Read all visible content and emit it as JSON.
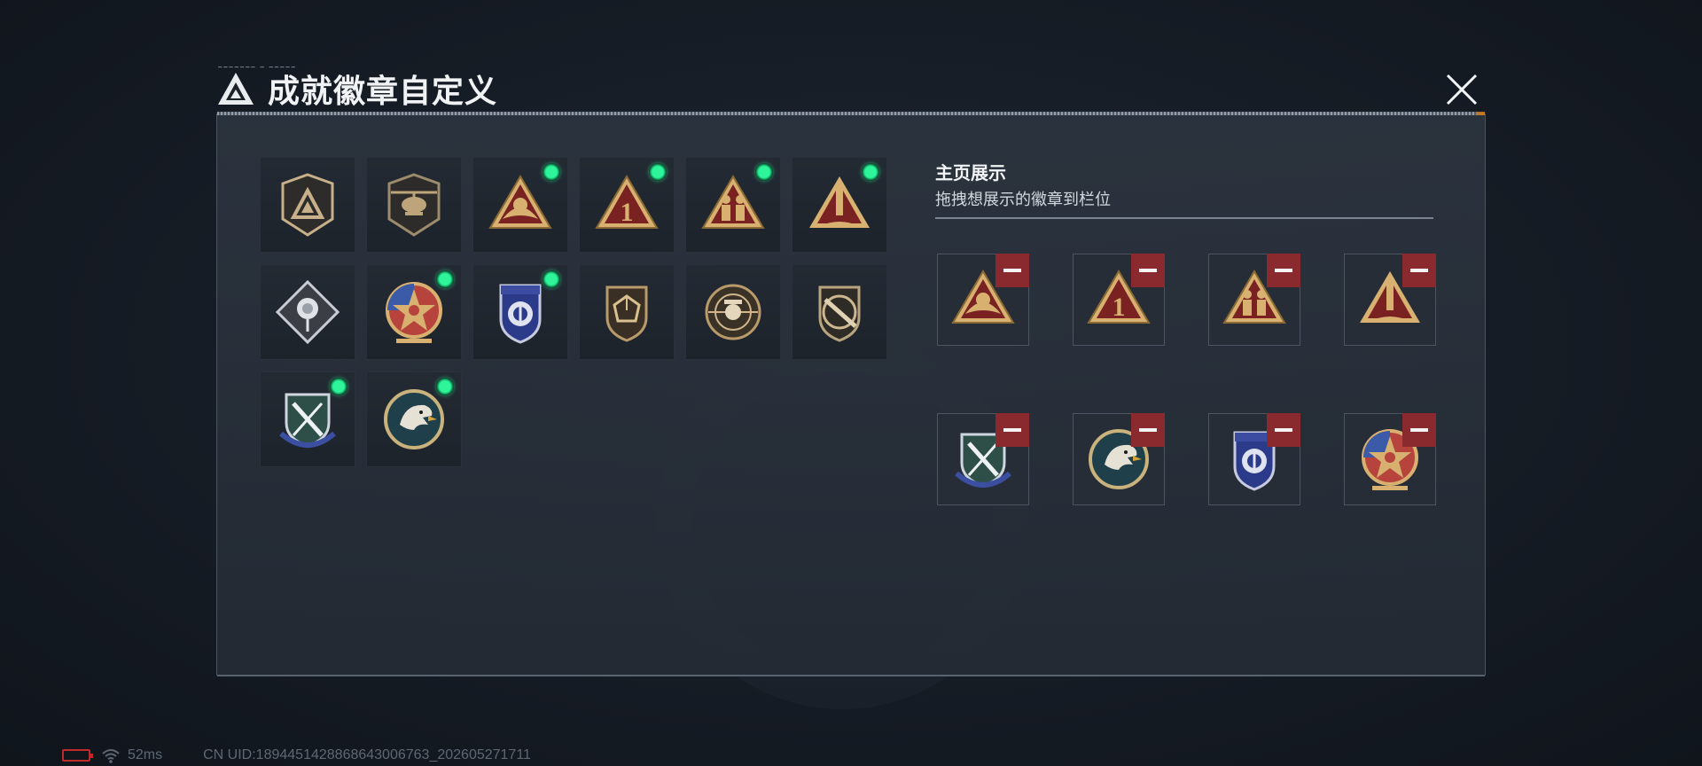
{
  "title": {
    "text": "成就徽章自定义",
    "deco_text": "━━━━━━━ ━ ━━━━━"
  },
  "showcase": {
    "title": "主页展示",
    "subtitle": "拖拽想展示的徽章到栏位"
  },
  "colors": {
    "equipped_dot": "#2ef59a",
    "remove_button": "#8a2a2e",
    "accent_orange": "#e08a28",
    "battery_red": "#c02a2a"
  },
  "badges": [
    {
      "icon": "shield-triangle-emblem-icon",
      "equipped": false
    },
    {
      "icon": "helicopter-emblem-icon",
      "equipped": false
    },
    {
      "icon": "triangle-eagle-emblem-icon",
      "equipped": true
    },
    {
      "icon": "triangle-number-one-icon",
      "equipped": true
    },
    {
      "icon": "triangle-soldiers-emblem-icon",
      "equipped": true
    },
    {
      "icon": "triangle-rocket-emblem-icon",
      "equipped": true
    },
    {
      "icon": "diamond-rose-emblem-icon",
      "equipped": false
    },
    {
      "icon": "star-medallion-icon",
      "equipped": true
    },
    {
      "icon": "blue-police-shield-icon",
      "equipped": true
    },
    {
      "icon": "d20-dice-shield-icon",
      "equipped": false
    },
    {
      "icon": "skull-crosshair-emblem-icon",
      "equipped": false
    },
    {
      "icon": "rifle-shield-emblem-icon",
      "equipped": false
    },
    {
      "icon": "green-crossed-sword-shield-icon",
      "equipped": true
    },
    {
      "icon": "eagle-head-medallion-icon",
      "equipped": true
    }
  ],
  "showcase_slots": [
    {
      "icon": "triangle-eagle-emblem-icon"
    },
    {
      "icon": "triangle-number-one-icon"
    },
    {
      "icon": "triangle-soldiers-emblem-icon"
    },
    {
      "icon": "triangle-rocket-emblem-icon"
    },
    {
      "icon": "green-crossed-sword-shield-icon"
    },
    {
      "icon": "eagle-head-medallion-icon"
    },
    {
      "icon": "blue-police-shield-icon"
    },
    {
      "icon": "star-medallion-icon"
    }
  ],
  "status": {
    "ping": "52ms",
    "uid": "CN UID:1894451428868643006763_202605271711"
  }
}
